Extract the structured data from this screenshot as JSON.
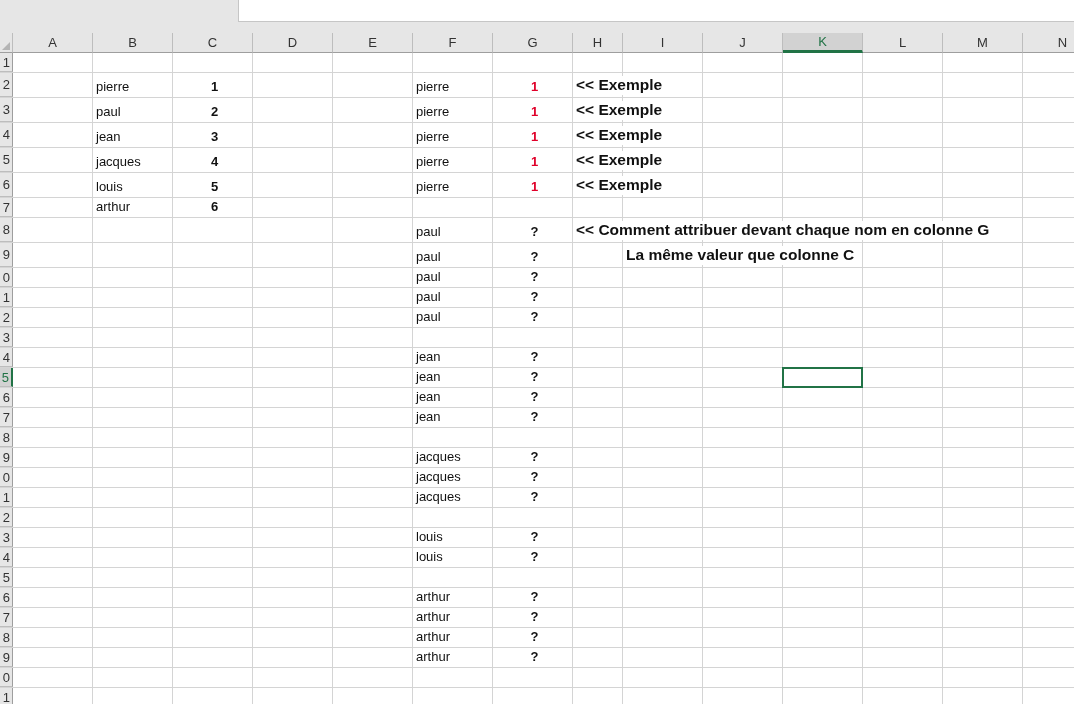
{
  "columns": [
    {
      "label": "A",
      "selected": false
    },
    {
      "label": "B",
      "selected": false
    },
    {
      "label": "C",
      "selected": false
    },
    {
      "label": "D",
      "selected": false
    },
    {
      "label": "E",
      "selected": false
    },
    {
      "label": "F",
      "selected": false
    },
    {
      "label": "G",
      "selected": false
    },
    {
      "label": "H",
      "selected": false
    },
    {
      "label": "I",
      "selected": false
    },
    {
      "label": "J",
      "selected": false
    },
    {
      "label": "K",
      "selected": true
    },
    {
      "label": "L",
      "selected": false
    },
    {
      "label": "M",
      "selected": false
    },
    {
      "label": "N",
      "selected": false
    }
  ],
  "rows": [
    {
      "number": "1",
      "selected": false
    },
    {
      "number": "2",
      "selected": false,
      "cells": {
        "B": {
          "text": "pierre",
          "kind": "name"
        },
        "C": {
          "text": "1",
          "kind": "number"
        },
        "F": {
          "text": "pierre",
          "kind": "name"
        },
        "G": {
          "text": "1",
          "kind": "example"
        },
        "H": {
          "text": "<< Exemple",
          "kind": "note"
        }
      }
    },
    {
      "number": "3",
      "selected": false,
      "cells": {
        "B": {
          "text": "paul",
          "kind": "name"
        },
        "C": {
          "text": "2",
          "kind": "number"
        },
        "F": {
          "text": "pierre",
          "kind": "name"
        },
        "G": {
          "text": "1",
          "kind": "example"
        },
        "H": {
          "text": "<< Exemple",
          "kind": "note"
        }
      }
    },
    {
      "number": "4",
      "selected": false,
      "cells": {
        "B": {
          "text": "jean",
          "kind": "name"
        },
        "C": {
          "text": "3",
          "kind": "number"
        },
        "F": {
          "text": "pierre",
          "kind": "name"
        },
        "G": {
          "text": "1",
          "kind": "example"
        },
        "H": {
          "text": "<< Exemple",
          "kind": "note"
        }
      }
    },
    {
      "number": "5",
      "selected": false,
      "cells": {
        "B": {
          "text": "jacques",
          "kind": "name"
        },
        "C": {
          "text": "4",
          "kind": "number"
        },
        "F": {
          "text": "pierre",
          "kind": "name"
        },
        "G": {
          "text": "1",
          "kind": "example"
        },
        "H": {
          "text": "<< Exemple",
          "kind": "note"
        }
      }
    },
    {
      "number": "6",
      "selected": false,
      "cells": {
        "B": {
          "text": "louis",
          "kind": "name"
        },
        "C": {
          "text": "5",
          "kind": "number"
        },
        "F": {
          "text": "pierre",
          "kind": "name"
        },
        "G": {
          "text": "1",
          "kind": "example"
        },
        "H": {
          "text": "<< Exemple",
          "kind": "note"
        }
      }
    },
    {
      "number": "7",
      "selected": false,
      "cells": {
        "B": {
          "text": "arthur",
          "kind": "name"
        },
        "C": {
          "text": "6",
          "kind": "number"
        }
      }
    },
    {
      "number": "8",
      "selected": false,
      "cells": {
        "F": {
          "text": "paul",
          "kind": "name"
        },
        "G": {
          "text": "?",
          "kind": "number"
        },
        "H": {
          "text": "<< Comment attribuer devant chaque nom en colonne G",
          "kind": "note"
        }
      }
    },
    {
      "number": "9",
      "selected": false,
      "cells": {
        "F": {
          "text": "paul",
          "kind": "name"
        },
        "G": {
          "text": "?",
          "kind": "number"
        },
        "I": {
          "text": "La même valeur que colonne C",
          "kind": "note"
        }
      }
    },
    {
      "number": "0",
      "selected": false,
      "cells": {
        "F": {
          "text": "paul",
          "kind": "name"
        },
        "G": {
          "text": "?",
          "kind": "number"
        }
      }
    },
    {
      "number": "1",
      "selected": false,
      "cells": {
        "F": {
          "text": "paul",
          "kind": "name"
        },
        "G": {
          "text": "?",
          "kind": "number"
        }
      }
    },
    {
      "number": "2",
      "selected": false,
      "cells": {
        "F": {
          "text": "paul",
          "kind": "name"
        },
        "G": {
          "text": "?",
          "kind": "number"
        }
      }
    },
    {
      "number": "3",
      "selected": false
    },
    {
      "number": "4",
      "selected": false,
      "cells": {
        "F": {
          "text": "jean",
          "kind": "name"
        },
        "G": {
          "text": "?",
          "kind": "number"
        }
      }
    },
    {
      "number": "5",
      "selected": true,
      "cells": {
        "F": {
          "text": "jean",
          "kind": "name"
        },
        "G": {
          "text": "?",
          "kind": "number"
        }
      }
    },
    {
      "number": "6",
      "selected": false,
      "cells": {
        "F": {
          "text": "jean",
          "kind": "name"
        },
        "G": {
          "text": "?",
          "kind": "number"
        }
      }
    },
    {
      "number": "7",
      "selected": false,
      "cells": {
        "F": {
          "text": "jean",
          "kind": "name"
        },
        "G": {
          "text": "?",
          "kind": "number"
        }
      }
    },
    {
      "number": "8",
      "selected": false
    },
    {
      "number": "9",
      "selected": false,
      "cells": {
        "F": {
          "text": "jacques",
          "kind": "name"
        },
        "G": {
          "text": "?",
          "kind": "number"
        }
      }
    },
    {
      "number": "0",
      "selected": false,
      "cells": {
        "F": {
          "text": "jacques",
          "kind": "name"
        },
        "G": {
          "text": "?",
          "kind": "number"
        }
      }
    },
    {
      "number": "1",
      "selected": false,
      "cells": {
        "F": {
          "text": "jacques",
          "kind": "name"
        },
        "G": {
          "text": "?",
          "kind": "number"
        }
      }
    },
    {
      "number": "2",
      "selected": false
    },
    {
      "number": "3",
      "selected": false,
      "cells": {
        "F": {
          "text": "louis",
          "kind": "name"
        },
        "G": {
          "text": "?",
          "kind": "number"
        }
      }
    },
    {
      "number": "4",
      "selected": false,
      "cells": {
        "F": {
          "text": "louis",
          "kind": "name"
        },
        "G": {
          "text": "?",
          "kind": "number"
        }
      }
    },
    {
      "number": "5",
      "selected": false
    },
    {
      "number": "6",
      "selected": false,
      "cells": {
        "F": {
          "text": "arthur",
          "kind": "name"
        },
        "G": {
          "text": "?",
          "kind": "number"
        }
      }
    },
    {
      "number": "7",
      "selected": false,
      "cells": {
        "F": {
          "text": "arthur",
          "kind": "name"
        },
        "G": {
          "text": "?",
          "kind": "number"
        }
      }
    },
    {
      "number": "8",
      "selected": false,
      "cells": {
        "F": {
          "text": "arthur",
          "kind": "name"
        },
        "G": {
          "text": "?",
          "kind": "number"
        }
      }
    },
    {
      "number": "9",
      "selected": false,
      "cells": {
        "F": {
          "text": "arthur",
          "kind": "name"
        },
        "G": {
          "text": "?",
          "kind": "number"
        }
      }
    },
    {
      "number": "0",
      "selected": false
    },
    {
      "number": "1",
      "selected": false
    }
  ]
}
